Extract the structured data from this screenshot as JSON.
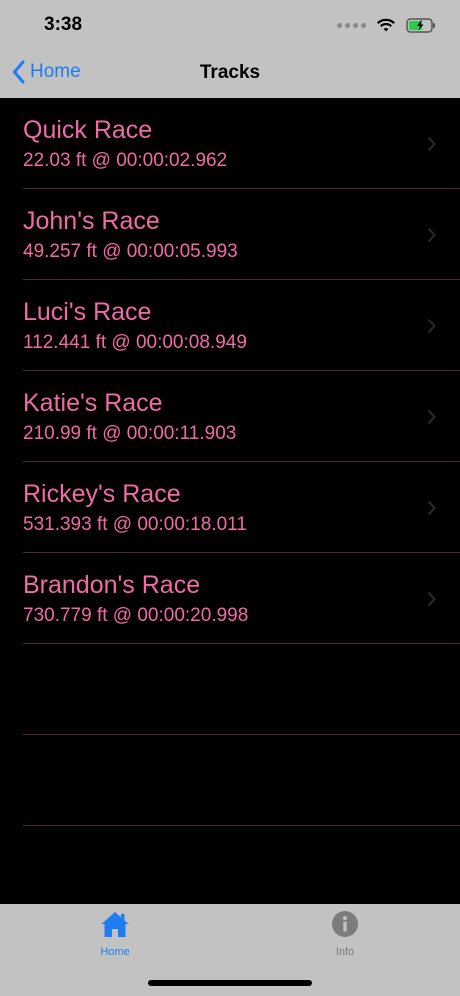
{
  "status_bar": {
    "time": "3:38"
  },
  "nav": {
    "back_label": "Home",
    "title": "Tracks"
  },
  "races": [
    {
      "name": "Quick Race",
      "detail": "22.03 ft @ 00:00:02.962"
    },
    {
      "name": "John's Race",
      "detail": "49.257 ft @ 00:00:05.993"
    },
    {
      "name": "Luci's Race",
      "detail": "112.441 ft @ 00:00:08.949"
    },
    {
      "name": "Katie's Race",
      "detail": "210.99 ft @ 00:00:11.903"
    },
    {
      "name": "Rickey's Race",
      "detail": "531.393 ft @ 00:00:18.011"
    },
    {
      "name": "Brandon's Race",
      "detail": "730.779 ft @ 00:00:20.998"
    }
  ],
  "tabbar": {
    "home_label": "Home",
    "info_label": "Info"
  },
  "colors": {
    "accent": "#1f7cf3",
    "text_pink": "#f06aa6",
    "bar_gray": "#c2c2c2",
    "background": "#000000"
  }
}
